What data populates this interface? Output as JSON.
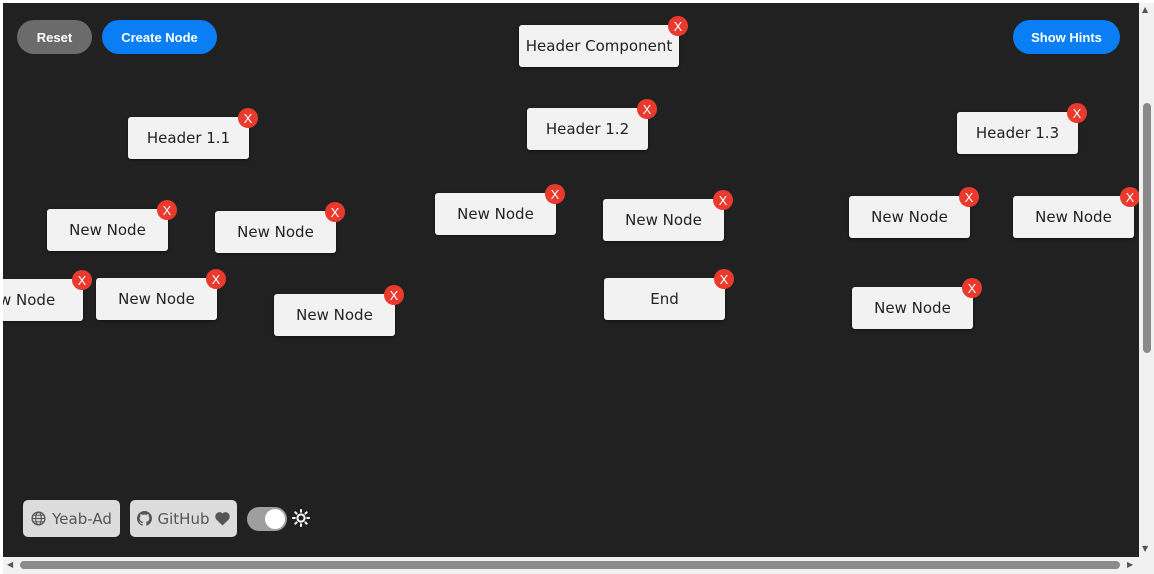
{
  "toolbar": {
    "reset_label": "Reset",
    "create_label": "Create Node",
    "hints_label": "Show Hints"
  },
  "node_delete_label": "X",
  "nodes": [
    {
      "id": "header-component",
      "label": "Header Component"
    },
    {
      "id": "header-1-1",
      "label": "Header 1.1"
    },
    {
      "id": "header-1-2",
      "label": "Header 1.2"
    },
    {
      "id": "header-1-3",
      "label": "Header 1.3"
    },
    {
      "id": "new-node-1",
      "label": "New Node"
    },
    {
      "id": "new-node-2",
      "label": "New Node"
    },
    {
      "id": "new-node-3",
      "label": "w Node"
    },
    {
      "id": "new-node-4",
      "label": "New Node"
    },
    {
      "id": "new-node-5",
      "label": "New Node"
    },
    {
      "id": "new-node-6",
      "label": "New Node"
    },
    {
      "id": "new-node-7",
      "label": "New Node"
    },
    {
      "id": "end",
      "label": "End"
    },
    {
      "id": "new-node-8",
      "label": "New Node"
    },
    {
      "id": "new-node-9",
      "label": "New Node"
    },
    {
      "id": "new-node-10",
      "label": "New Node"
    }
  ],
  "footer": {
    "website_label": "Yeab-Ad",
    "github_label": "GitHub",
    "website_icon": "globe-icon",
    "github_icon": "github-icon",
    "heart_icon": "heart-icon",
    "theme_icon": "sun-icon",
    "theme_toggle_on": true
  },
  "colors": {
    "canvas": "#212121",
    "primary": "#0a7ef5",
    "reset": "#6b6b6b",
    "delete": "#ea3a2e",
    "node": "#f2f2f2"
  }
}
